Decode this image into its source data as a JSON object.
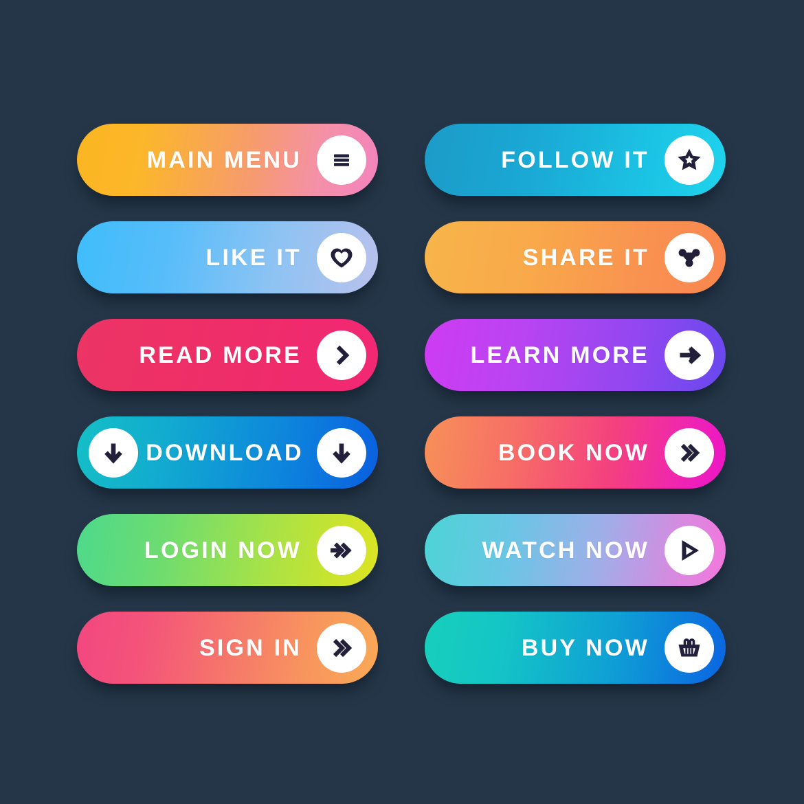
{
  "page": {
    "title": "Gradient Action Button Set",
    "background_color": "#243648"
  },
  "icon_color": "#221F3B",
  "icon_circle_color": "#FFFFFF",
  "label_color": "#FFFFFF",
  "buttons": [
    {
      "id": "main-menu",
      "label": "Main Menu",
      "icon": "hamburger-menu-icon",
      "left_icon": null,
      "gradient_from": "#FBB521",
      "gradient_to": "#F383BE",
      "column": "left",
      "row": 1
    },
    {
      "id": "follow-it",
      "label": "Follow It",
      "icon": "star-icon",
      "left_icon": null,
      "gradient_from": "#1C9BC8",
      "gradient_to": "#1FD3ED",
      "column": "right",
      "row": 1
    },
    {
      "id": "like-it",
      "label": "Like It",
      "icon": "heart-icon",
      "left_icon": null,
      "gradient_from": "#3FBDFB",
      "gradient_to": "#B9C1EC",
      "column": "left",
      "row": 2
    },
    {
      "id": "share-it",
      "label": "Share It",
      "icon": "share-nodes-icon",
      "left_icon": null,
      "gradient_from": "#F7B54A",
      "gradient_to": "#F9854F",
      "column": "right",
      "row": 2
    },
    {
      "id": "read-more",
      "label": "Read More",
      "icon": "chevron-right-icon",
      "left_icon": null,
      "gradient_from": "#EC3465",
      "gradient_to": "#F22873",
      "column": "left",
      "row": 3
    },
    {
      "id": "learn-more",
      "label": "Learn More",
      "icon": "arrow-right-icon",
      "left_icon": null,
      "gradient_from": "#CE3BF2",
      "gradient_to": "#6748EE",
      "column": "right",
      "row": 3
    },
    {
      "id": "download",
      "label": "Download",
      "icon": "arrow-down-icon",
      "left_icon": "arrow-down-icon",
      "gradient_from": "#14BFC6",
      "gradient_to": "#0A5FE0",
      "column": "left",
      "row": 4
    },
    {
      "id": "book-now",
      "label": "Book Now",
      "icon": "double-chevron-right-icon",
      "left_icon": null,
      "gradient_from": "#F79158",
      "gradient_to": "#ED15C6",
      "column": "right",
      "row": 4
    },
    {
      "id": "login-now",
      "label": "Login Now",
      "icon": "arrow-double-chevron-right-icon",
      "left_icon": null,
      "gradient_from": "#4DD98C",
      "gradient_to": "#DBE423",
      "column": "left",
      "row": 5
    },
    {
      "id": "watch-now",
      "label": "Watch Now",
      "icon": "play-icon",
      "left_icon": null,
      "gradient_from": "#4CD4D6",
      "gradient_to": "#F576DE",
      "column": "right",
      "row": 5
    },
    {
      "id": "sign-in",
      "label": "Sign In",
      "icon": "double-chevron-right-icon",
      "left_icon": null,
      "gradient_from": "#F24780",
      "gradient_to": "#F9A955",
      "column": "left",
      "row": 6
    },
    {
      "id": "buy-now",
      "label": "Buy Now",
      "icon": "shopping-basket-icon",
      "left_icon": null,
      "gradient_from": "#17CFBC",
      "gradient_to": "#0A64E2",
      "column": "right",
      "row": 6
    }
  ]
}
